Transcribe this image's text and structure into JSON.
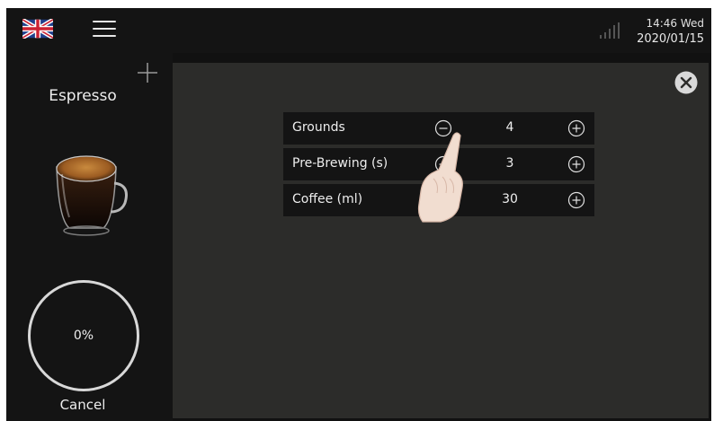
{
  "status": {
    "time": "14:46 Wed",
    "date": "2020/01/15"
  },
  "icons": {
    "language": "uk-flag-icon",
    "menu": "hamburger-menu-icon",
    "signal": "signal-strength-icon",
    "add": "plus-icon",
    "close": "close-circle-icon"
  },
  "drink": {
    "name": "Espresso"
  },
  "progress": {
    "value_text": "0%",
    "value": 0,
    "cancel_label": "Cancel"
  },
  "params": [
    {
      "label": "Grounds",
      "value": "4"
    },
    {
      "label": "Pre-Brewing (s)",
      "value": "3"
    },
    {
      "label": "Coffee (ml)",
      "value": "30"
    }
  ],
  "colors": {
    "background": "#111111",
    "main_panel": "#2c2c2a",
    "text": "#eeeeee"
  }
}
